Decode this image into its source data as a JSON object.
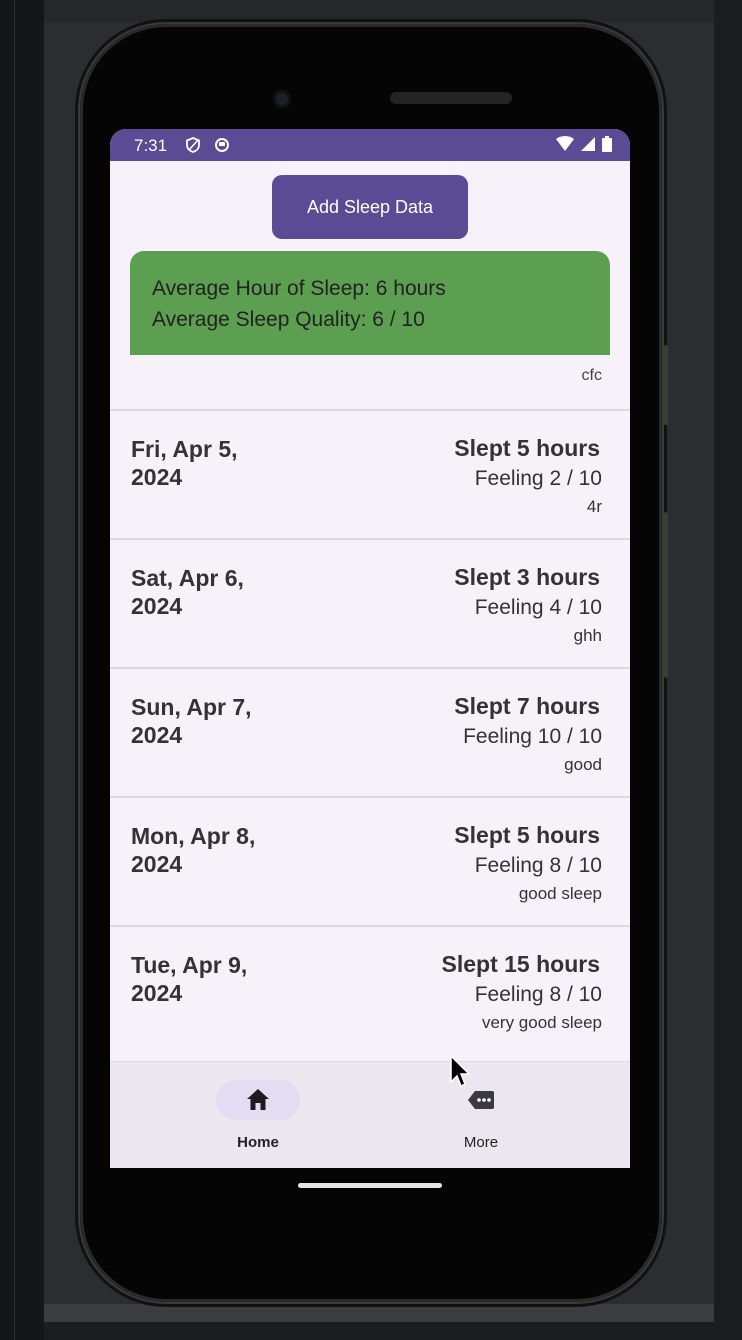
{
  "statusbar": {
    "time": "7:31"
  },
  "actions": {
    "add_sleep_label": "Add Sleep Data"
  },
  "summary": {
    "average_hours": "Average Hour of Sleep: 6 hours",
    "average_quality": "Average Sleep Quality: 6 / 10"
  },
  "partial_entry": {
    "note": "cfc"
  },
  "entries": [
    {
      "date": "Fri, Apr 5, 2024",
      "slept": "Slept 5 hours",
      "feeling": "Feeling 2 / 10",
      "note": "4r"
    },
    {
      "date": "Sat, Apr 6, 2024",
      "slept": "Slept 3 hours",
      "feeling": "Feeling 4 / 10",
      "note": "ghh"
    },
    {
      "date": "Sun, Apr 7, 2024",
      "slept": "Slept 7 hours",
      "feeling": "Feeling 10 / 10",
      "note": "good"
    },
    {
      "date": "Mon, Apr 8, 2024",
      "slept": "Slept 5 hours",
      "feeling": "Feeling 8 / 10",
      "note": "good sleep"
    },
    {
      "date": "Tue, Apr 9, 2024",
      "slept": "Slept 15 hours",
      "feeling": "Feeling 8 / 10",
      "note": "very good sleep"
    }
  ],
  "bottom_nav": [
    {
      "label": "Home",
      "icon": "home-icon",
      "selected": true
    },
    {
      "label": "More",
      "icon": "more-icon",
      "selected": false
    }
  ],
  "colors": {
    "primary": "#5b4b95",
    "summary_bg": "#5c9f50",
    "surface": "#f7f2fa",
    "nav_bg": "#ece6f0"
  }
}
